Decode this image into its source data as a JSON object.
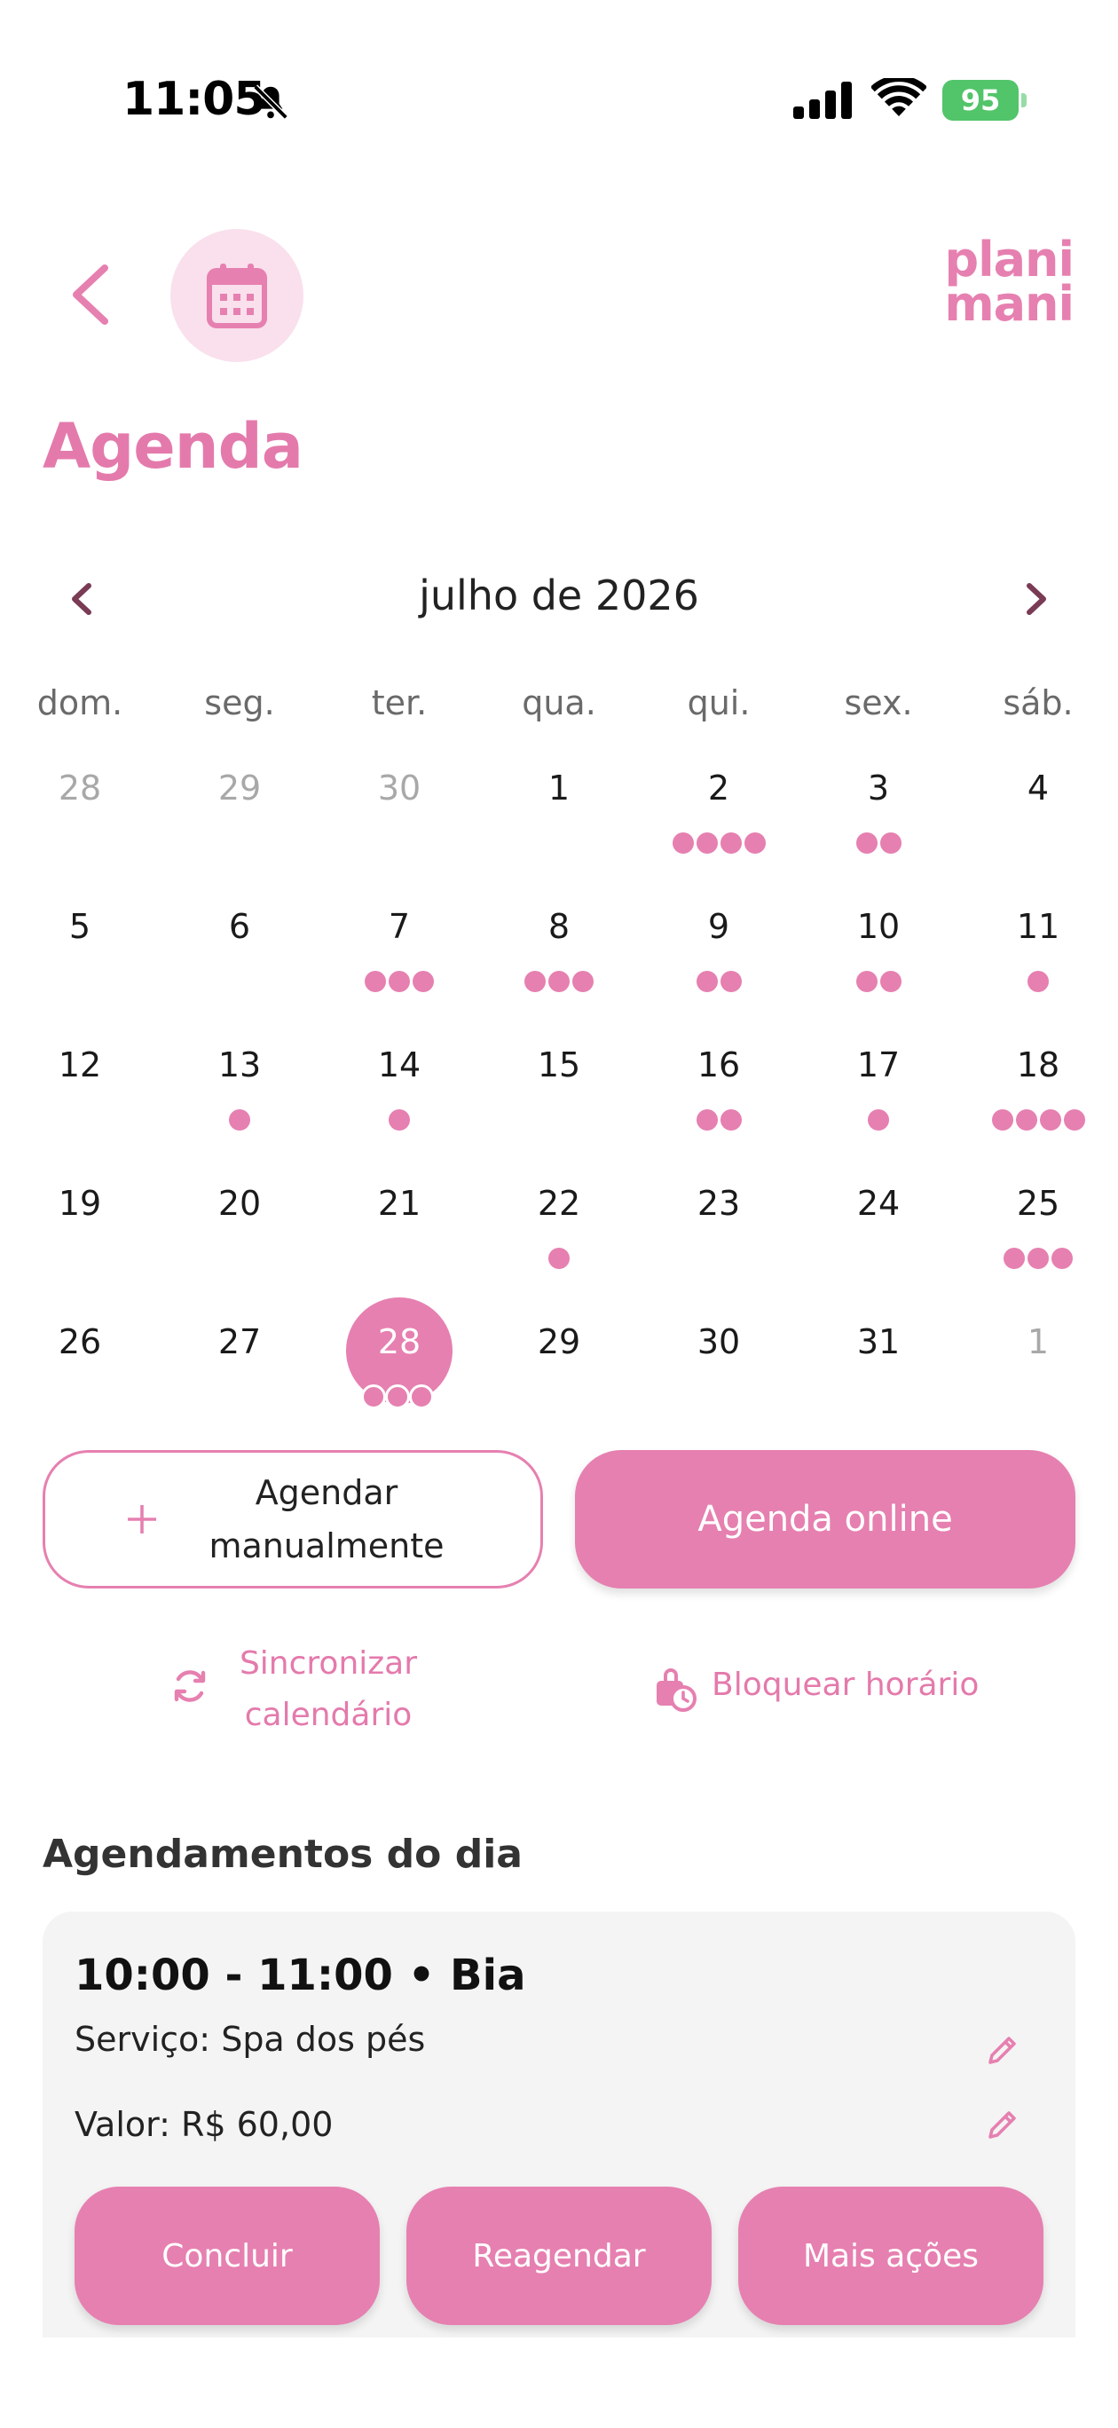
{
  "status": {
    "time": "11:05",
    "battery": "95"
  },
  "header": {
    "logo_line1": "plani",
    "logo_line2": "mani",
    "title": "Agenda"
  },
  "calendar": {
    "month_label": "julho de 2026",
    "weekdays": [
      "dom.",
      "seg.",
      "ter.",
      "qua.",
      "qui.",
      "sex.",
      "sáb."
    ],
    "weeks": [
      [
        {
          "n": "28",
          "muted": true,
          "dots": 0
        },
        {
          "n": "29",
          "muted": true,
          "dots": 0
        },
        {
          "n": "30",
          "muted": true,
          "dots": 0
        },
        {
          "n": "1",
          "dots": 0
        },
        {
          "n": "2",
          "dots": 4
        },
        {
          "n": "3",
          "dots": 2
        },
        {
          "n": "4",
          "dots": 0
        }
      ],
      [
        {
          "n": "5",
          "dots": 0
        },
        {
          "n": "6",
          "dots": 0
        },
        {
          "n": "7",
          "dots": 3
        },
        {
          "n": "8",
          "dots": 3
        },
        {
          "n": "9",
          "dots": 2
        },
        {
          "n": "10",
          "dots": 2
        },
        {
          "n": "11",
          "dots": 1
        }
      ],
      [
        {
          "n": "12",
          "dots": 0
        },
        {
          "n": "13",
          "dots": 1
        },
        {
          "n": "14",
          "dots": 1
        },
        {
          "n": "15",
          "dots": 0
        },
        {
          "n": "16",
          "dots": 2
        },
        {
          "n": "17",
          "dots": 1
        },
        {
          "n": "18",
          "dots": 4
        }
      ],
      [
        {
          "n": "19",
          "dots": 0
        },
        {
          "n": "20",
          "dots": 0
        },
        {
          "n": "21",
          "dots": 0
        },
        {
          "n": "22",
          "dots": 1
        },
        {
          "n": "23",
          "dots": 0
        },
        {
          "n": "24",
          "dots": 0
        },
        {
          "n": "25",
          "dots": 3
        }
      ],
      [
        {
          "n": "26",
          "dots": 0
        },
        {
          "n": "27",
          "dots": 0
        },
        {
          "n": "28",
          "selected": true,
          "dots": 3
        },
        {
          "n": "29",
          "dots": 0
        },
        {
          "n": "30",
          "dots": 0
        },
        {
          "n": "31",
          "dots": 0
        },
        {
          "n": "1",
          "muted": true,
          "dots": 0
        }
      ]
    ]
  },
  "actions": {
    "manual_label": "Agendar manualmente",
    "online_label": "Agenda online",
    "sync_label": "Sincronizar calendário",
    "block_label": "Bloquear horário"
  },
  "appointments": {
    "section_title": "Agendamentos do dia",
    "items": [
      {
        "title": "10:00 - 11:00 • Bia",
        "service": "Serviço: Spa dos pés",
        "value": "Valor: R$ 60,00",
        "btn_conclude": "Concluir",
        "btn_reschedule": "Reagendar",
        "btn_more": "Mais ações"
      }
    ]
  },
  "colors": {
    "accent": "#e680b0",
    "accent_light": "#f9e0ec",
    "battery": "#52c46a",
    "card_bg": "#f4f4f4"
  }
}
